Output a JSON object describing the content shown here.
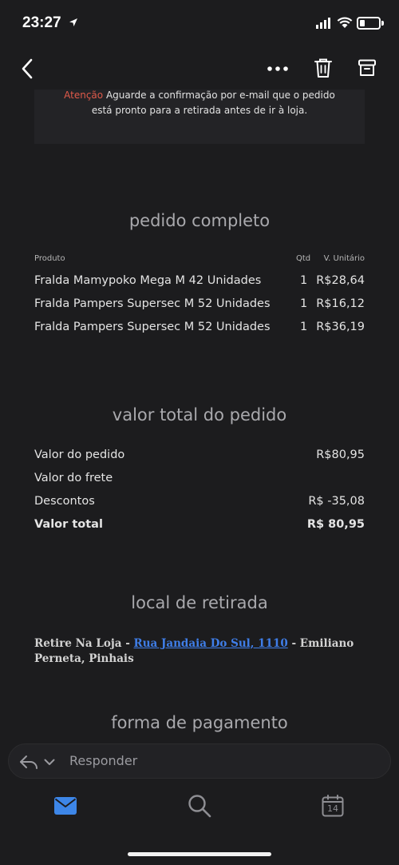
{
  "status_bar": {
    "time": "23:27"
  },
  "notice": {
    "accent": "Atenção",
    "line1": " Aguarde a confirmação por e-mail que o pedido",
    "line2": "está pronto para a retirada antes de ir à loja."
  },
  "order": {
    "title": "pedido completo",
    "columns": {
      "product": "Produto",
      "qty": "Qtd",
      "unit_price": "V. Unitário"
    },
    "items": [
      {
        "name": "Fralda Mamypoko Mega M 42 Unidades",
        "qty": "1",
        "price": "R$28,64"
      },
      {
        "name": "Fralda Pampers Supersec M 52 Unidades",
        "qty": "1",
        "price": "R$16,12"
      },
      {
        "name": "Fralda Pampers Supersec M 52 Unidades",
        "qty": "1",
        "price": "R$36,19"
      }
    ]
  },
  "totals": {
    "title": "valor total do pedido",
    "rows": [
      {
        "label": "Valor do pedido",
        "value": "R$80,95"
      },
      {
        "label": "Valor do frete",
        "value": ""
      },
      {
        "label": "Descontos",
        "value": "R$ -35,08"
      },
      {
        "label": "Valor total",
        "value": "R$ 80,95"
      }
    ]
  },
  "pickup": {
    "title": "local de retirada",
    "prefix": "Retire Na Loja - ",
    "link": "Rua Jandaia Do Sul, 1110",
    "suffix": " - Emiliano Perneta, Pinhais"
  },
  "payment": {
    "title": "forma de pagamento"
  },
  "reply": {
    "label": "Responder"
  },
  "tabs": {
    "calendar_day": "14"
  },
  "colors": {
    "background": "#1c1c1e",
    "accent_red": "#e05a4a",
    "link_blue": "#3f7ee8",
    "tab_active": "#3d86e8"
  }
}
